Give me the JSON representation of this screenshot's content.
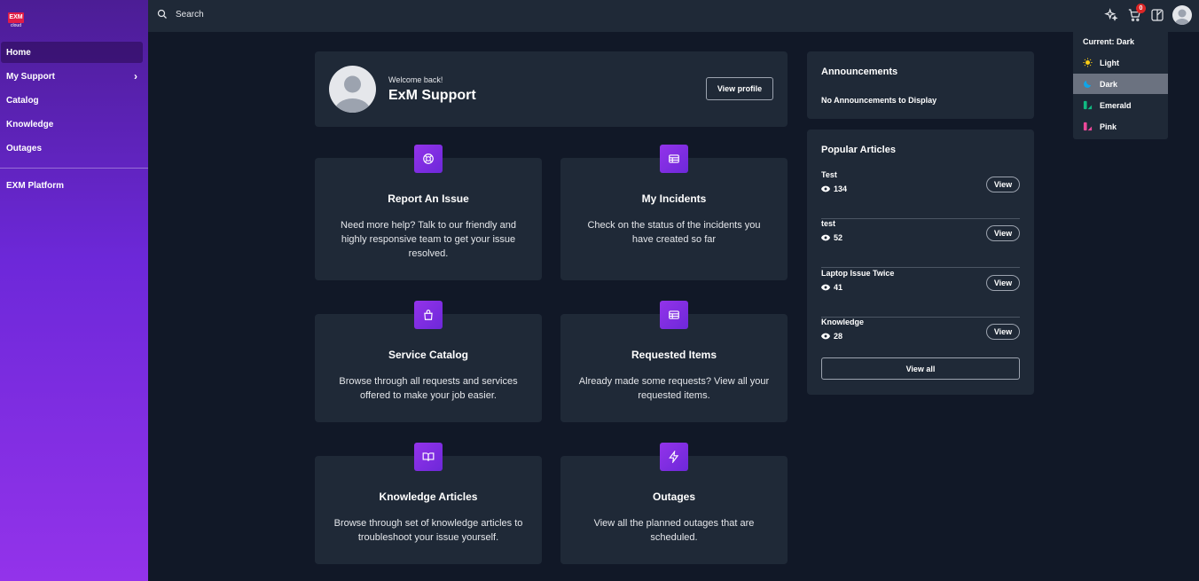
{
  "brand": {
    "logo_text": "EXM",
    "logo_sub": "cloud",
    "accent": "#9333ea"
  },
  "sidebar": {
    "items": [
      {
        "label": "Home"
      },
      {
        "label": "My Support"
      },
      {
        "label": "Catalog"
      },
      {
        "label": "Knowledge"
      },
      {
        "label": "Outages"
      }
    ],
    "footer_item": "EXM Platform"
  },
  "topbar": {
    "search_label": "Search",
    "cart_count": "0",
    "icons": [
      "sparkles-icon",
      "cart-icon",
      "theme-icon",
      "avatar"
    ]
  },
  "welcome": {
    "greeting": "Welcome back!",
    "name": "ExM Support",
    "button": "View profile"
  },
  "tiles": [
    {
      "title": "Report An Issue",
      "desc": "Need more help? Talk to our friendly and highly responsive team to get your issue resolved.",
      "icon": "lifebuoy-icon"
    },
    {
      "title": "My Incidents",
      "desc": "Check on the status of the incidents you have created so far",
      "icon": "table-icon"
    },
    {
      "title": "Service Catalog",
      "desc": "Browse through all requests and services offered to make your job easier.",
      "icon": "bag-icon"
    },
    {
      "title": "Requested Items",
      "desc": "Already made some requests? View all your requested items.",
      "icon": "table-icon"
    },
    {
      "title": "Knowledge Articles",
      "desc": "Browse through set of knowledge articles to troubleshoot your issue yourself.",
      "icon": "book-icon"
    },
    {
      "title": "Outages",
      "desc": "View all the planned outages that are scheduled.",
      "icon": "bolt-icon"
    }
  ],
  "announcements": {
    "title": "Announcements",
    "empty": "No Announcements to Display"
  },
  "popular": {
    "title": "Popular Articles",
    "articles": [
      {
        "title": "Test",
        "views": "134",
        "button": "View"
      },
      {
        "title": "test",
        "views": "52",
        "button": "View"
      },
      {
        "title": "Laptop Issue Twice",
        "views": "41",
        "button": "View"
      },
      {
        "title": "Knowledge",
        "views": "28",
        "button": "View"
      }
    ],
    "view_all": "View all"
  },
  "theme_menu": {
    "current": "Current: Dark",
    "options": [
      {
        "label": "Light",
        "color": "#facc15"
      },
      {
        "label": "Dark",
        "color": "#0ea5e9"
      },
      {
        "label": "Emerald",
        "color": "#10b981"
      },
      {
        "label": "Pink",
        "color": "#ec4899"
      }
    ],
    "selected": "Dark"
  }
}
